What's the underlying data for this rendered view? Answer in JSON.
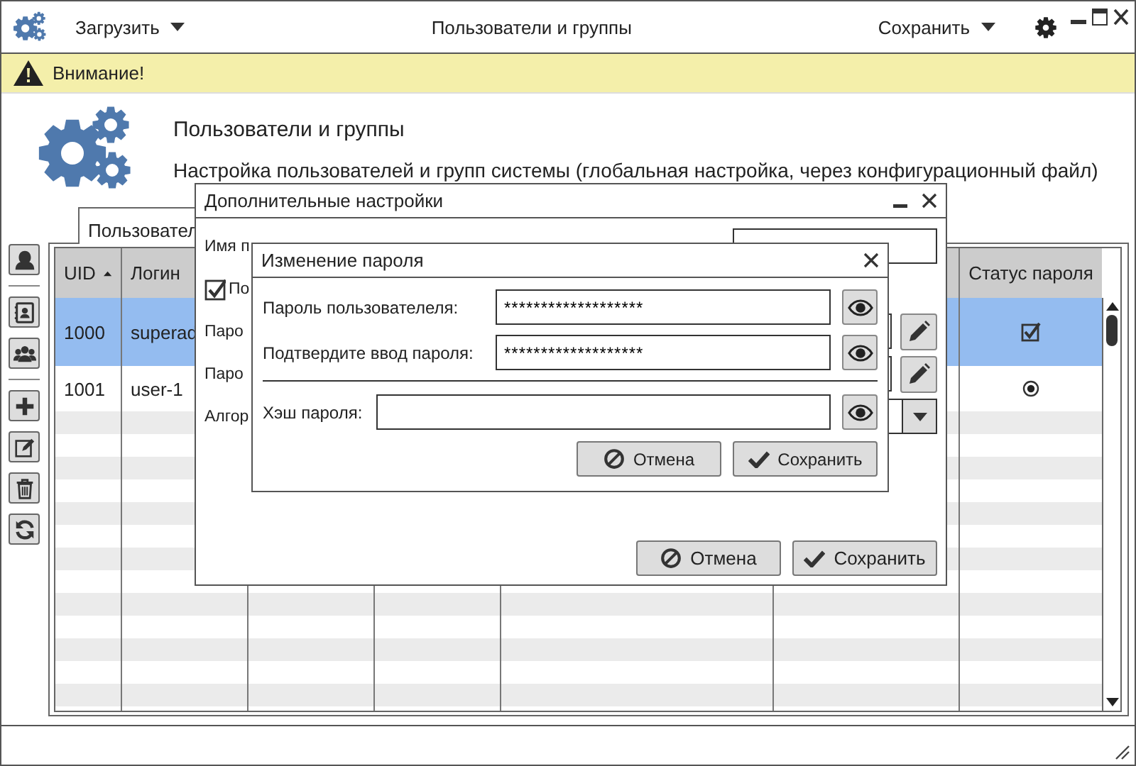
{
  "window": {
    "title": "Пользователи и группы",
    "load_menu": "Загрузить",
    "save_menu": "Сохранить"
  },
  "warning": {
    "text": "Внимание!"
  },
  "header": {
    "title": "Пользователи и группы",
    "subtitle": "Настройка пользователей и групп системы (глобальная настройка, через конфигурационный файл)"
  },
  "tabs": [
    {
      "label": "Пользовател",
      "selected": true
    }
  ],
  "toolbar": [
    {
      "kind": "user"
    },
    {
      "kind": "separator"
    },
    {
      "kind": "contact"
    },
    {
      "kind": "group"
    },
    {
      "kind": "separator"
    },
    {
      "kind": "add"
    },
    {
      "kind": "edit"
    },
    {
      "kind": "delete"
    },
    {
      "kind": "refresh"
    }
  ],
  "table": {
    "columns": [
      {
        "label": "UID",
        "sort_ascending": true
      },
      {
        "label": "Логин"
      },
      {},
      {},
      {},
      {},
      {
        "label": "Статус пароля"
      }
    ],
    "rows": [
      {
        "uid": "1000",
        "login": "superad",
        "selected": true,
        "password_status": {
          "kind": "checkbox",
          "checked": true
        }
      },
      {
        "uid": "1001",
        "login": "user-1",
        "selected": false,
        "password_status": {
          "kind": "radio",
          "selected": true
        }
      }
    ]
  },
  "settings_dialog": {
    "title": "Дополнительные настройки",
    "name_label": "Имя п",
    "checkbox": {
      "label": "По",
      "checked": true
    },
    "password_rows": [
      {
        "label": "Паро"
      },
      {
        "label": "Паро"
      }
    ],
    "algorithm_label": "Алгор",
    "buttons": [
      {
        "kind": "cancel",
        "label": "Отмена"
      },
      {
        "kind": "save",
        "label": "Сохранить"
      }
    ]
  },
  "password_dialog": {
    "title": "Изменение пароля",
    "fields": [
      {
        "label": "Пароль пользователеля:",
        "value": "*******************"
      },
      {
        "label": "Подтвердите ввод пароля:",
        "value": "*******************"
      }
    ],
    "hash_field": {
      "label": "Хэш пароля:"
    },
    "buttons": [
      {
        "kind": "cancel",
        "label": "Отмена"
      },
      {
        "kind": "save",
        "label": "Сохранить"
      }
    ]
  }
}
